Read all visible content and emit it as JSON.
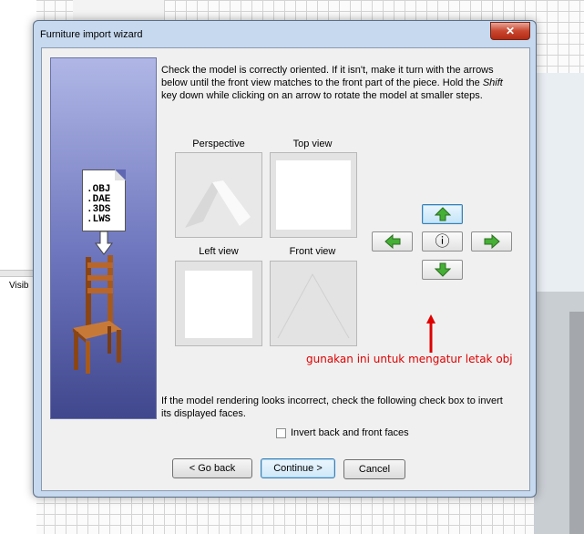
{
  "background": {
    "panel_label": "Visib"
  },
  "dialog": {
    "title": "Furniture import wizard",
    "close_glyph": "✕",
    "file_types": [
      ".OBJ",
      ".DAE",
      ".3DS",
      ".LWS"
    ],
    "instruction_parts": {
      "before": "Check the model is correctly oriented. If it isn't, make it turn with the arrows below until the front view matches to the front part of the piece. Hold the ",
      "key": "Shift",
      "after": " key down while clicking on an arrow to rotate the model at smaller steps."
    },
    "views": {
      "perspective": "Perspective",
      "top": "Top view",
      "left": "Left view",
      "front": "Front view"
    },
    "info_glyph": "ⓘ",
    "annotation": "gunakan ini untuk mengatur letak obj",
    "rendering_note": "If the model rendering looks incorrect, check the following check box to invert its displayed faces.",
    "checkbox_label": "Invert back and front faces",
    "checkbox_checked": false,
    "buttons": {
      "back": "< Go back",
      "continue": "Continue >",
      "cancel": "Cancel"
    },
    "colors": {
      "arrow_green": "#45b035",
      "annotation_red": "#e00000",
      "banner_top": "#b0b7e6",
      "banner_bottom": "#40478d"
    }
  }
}
